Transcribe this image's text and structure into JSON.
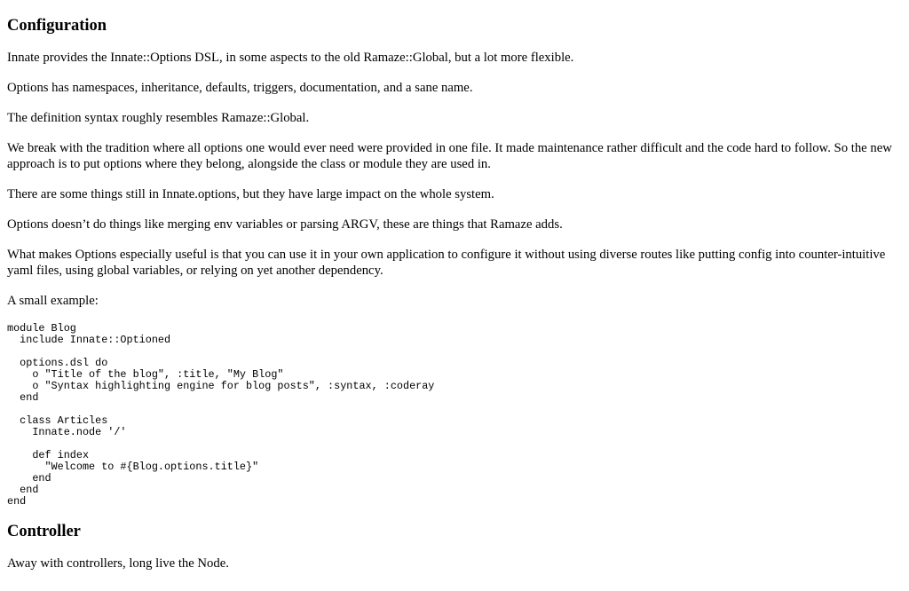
{
  "section1": {
    "heading": "Configuration",
    "paragraphs": [
      "Innate provides the Innate::Options DSL, in some aspects to the old Ramaze::Global, but a lot more flexible.",
      "Options has namespaces, inheritance, defaults, triggers, documentation, and a sane name.",
      "The definition syntax roughly resembles Ramaze::Global.",
      "We break with the tradition where all options one would ever need were provided in one file. It made maintenance rather difficult and the code hard to follow. So the new approach is to put options where they belong, alongside the class or module they are used in.",
      "There are some things still in Innate.options, but they have large impact on the whole system.",
      "Options doesn’t do things like merging env variables or parsing ARGV, these are things that Ramaze adds.",
      "What makes Options especially useful is that you can use it in your own application to configure it without using diverse routes like putting config into counter-intuitive yaml files, using global variables, or relying on yet another dependency.",
      "A small example:"
    ],
    "code": "module Blog\n  include Innate::Optioned\n\n  options.dsl do\n    o \"Title of the blog\", :title, \"My Blog\"\n    o \"Syntax highlighting engine for blog posts\", :syntax, :coderay\n  end\n\n  class Articles\n    Innate.node '/'\n\n    def index\n      \"Welcome to #{Blog.options.title}\"\n    end\n  end\nend"
  },
  "section2": {
    "heading": "Controller",
    "paragraphs": [
      "Away with controllers, long live the Node."
    ]
  }
}
